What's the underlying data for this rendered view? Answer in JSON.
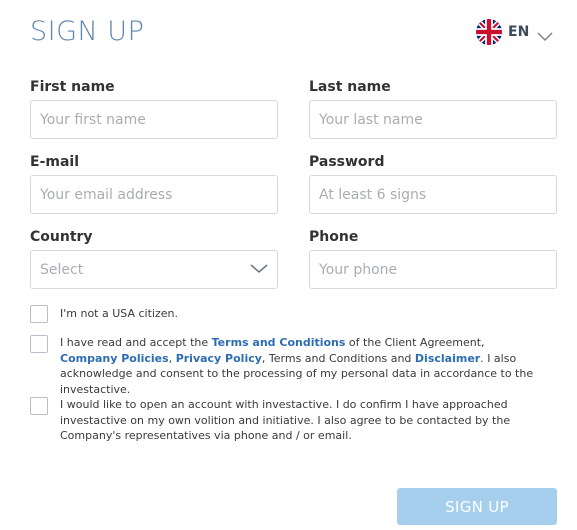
{
  "header": {
    "title": "SIGN UP",
    "language": {
      "code": "EN",
      "flag": "uk-flag-icon"
    }
  },
  "form": {
    "first_name": {
      "label": "First name",
      "placeholder": "Your first name"
    },
    "last_name": {
      "label": "Last name",
      "placeholder": "Your last name"
    },
    "email": {
      "label": "E-mail",
      "placeholder": "Your email address"
    },
    "password": {
      "label": "Password",
      "placeholder": "At least 6 signs"
    },
    "country": {
      "label": "Country",
      "value": "Select"
    },
    "phone": {
      "label": "Phone",
      "placeholder": "Your phone"
    }
  },
  "checkboxes": {
    "usa": {
      "text": "I'm not a USA citizen."
    },
    "terms": {
      "t1": "I have read and accept the ",
      "link_terms": "Terms and Conditions",
      "t2": " of the Client Agreement, ",
      "link_company": "Company Policies",
      "t3": ", ",
      "link_privacy": "Privacy Policy",
      "t4": ", Terms and Conditions and ",
      "link_disclaimer": "Disclaimer",
      "t5": ". I also acknowledge and consent to the processing of my personal data in accordance to the investactive."
    },
    "contact": {
      "text": "I would like to open an account with investactive. I do confirm I have approached investactive on my own volition and initiative. I also agree to be contacted by the Company's representatives via phone and / or email."
    }
  },
  "submit": {
    "label": "SIGN UP"
  },
  "colors": {
    "title": "#5e86b0",
    "link": "#2c6db3",
    "button_bg": "#a6cfee"
  }
}
